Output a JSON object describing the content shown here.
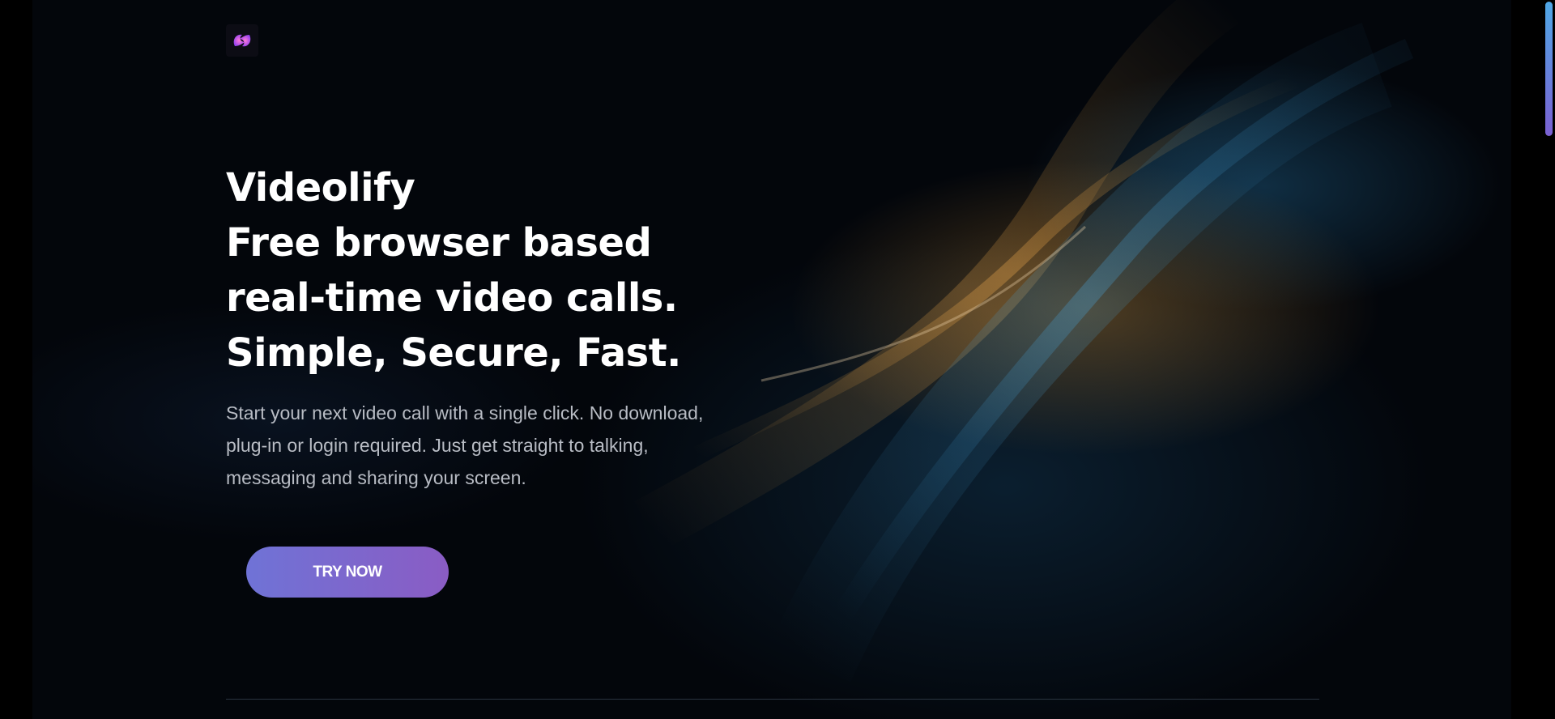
{
  "brand": {
    "logo_icon": "videolify-logo-icon",
    "accent_gradient": [
      "#6f73d6",
      "#8a5cc4"
    ]
  },
  "hero": {
    "title_lines": [
      "Videolify",
      "Free browser based",
      "real-time video calls.",
      "Simple, Secure, Fast."
    ],
    "description": "Start your next video call with a single click. No download, plug-in or login required. Just get straight to talking, messaging and sharing your screen.",
    "cta_label": "TRY NOW"
  },
  "colors": {
    "background": "#000000",
    "text_primary": "#ffffff",
    "text_secondary": "#b8bcc4",
    "ribbon_gold": "#d6963c",
    "ribbon_blue": "#2878aa"
  }
}
